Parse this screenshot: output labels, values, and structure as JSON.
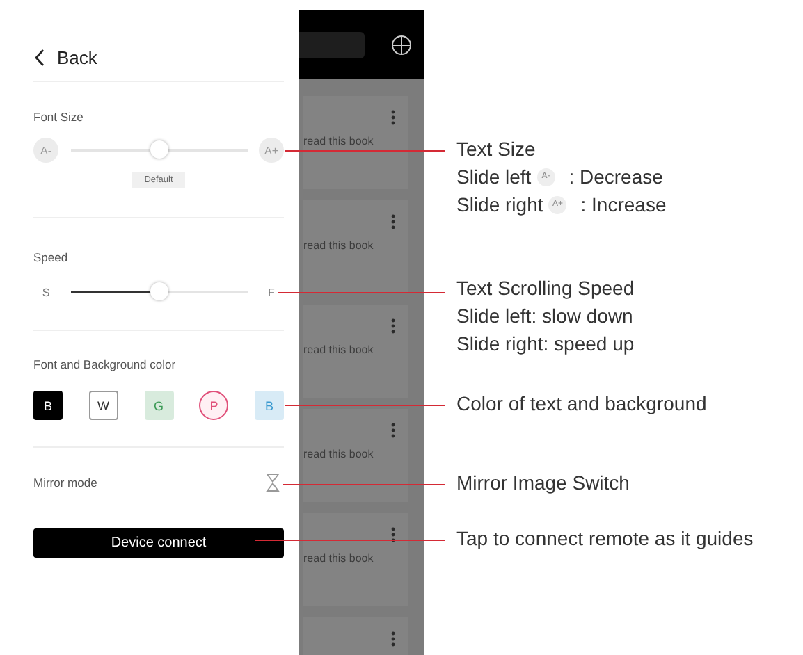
{
  "back": {
    "label": "Back"
  },
  "font_size": {
    "label": "Font Size",
    "decrease": "A-",
    "increase": "A+",
    "level": 0.5,
    "default_label": "Default"
  },
  "speed": {
    "label": "Speed",
    "slow": "S",
    "fast": "F",
    "level": 0.5
  },
  "color_theme": {
    "label": "Font and Background color",
    "options": [
      {
        "letter": "B",
        "kind": "solid",
        "color": "#000000",
        "selected": false
      },
      {
        "letter": "W",
        "kind": "outline",
        "color": "#333333",
        "selected": false
      },
      {
        "letter": "G",
        "kind": "tint",
        "color": "#3a9a55",
        "selected": false
      },
      {
        "letter": "P",
        "kind": "tint",
        "color": "#e0507a",
        "selected": true
      },
      {
        "letter": "B",
        "kind": "tint",
        "color": "#3a9ad0",
        "selected": false
      }
    ]
  },
  "mirror": {
    "label": "Mirror mode"
  },
  "connect_button": {
    "label": "Device connect"
  },
  "book_list": {
    "items": [
      {
        "title": "read this book"
      },
      {
        "title": "read this book"
      },
      {
        "title": "read this book"
      },
      {
        "title": "read this book"
      },
      {
        "title": "read this book"
      }
    ]
  },
  "annotations": [
    {
      "lines": [
        {
          "text": "Text Size"
        },
        {
          "text": "Slide left",
          "badge": "A-",
          "rest": ": Decrease"
        },
        {
          "text": "Slide right",
          "badge": "A+",
          "rest": ": Increase"
        }
      ]
    },
    {
      "lines": [
        {
          "text": "Text Scrolling Speed"
        },
        {
          "text": "Slide left: slow down"
        },
        {
          "text": "Slide right: speed up"
        }
      ]
    },
    {
      "lines": [
        {
          "text": "Color of text and background"
        }
      ]
    },
    {
      "lines": [
        {
          "text": "Mirror Image Switch"
        }
      ]
    },
    {
      "lines": [
        {
          "text": "Tap to connect remote as it guides"
        }
      ]
    }
  ]
}
